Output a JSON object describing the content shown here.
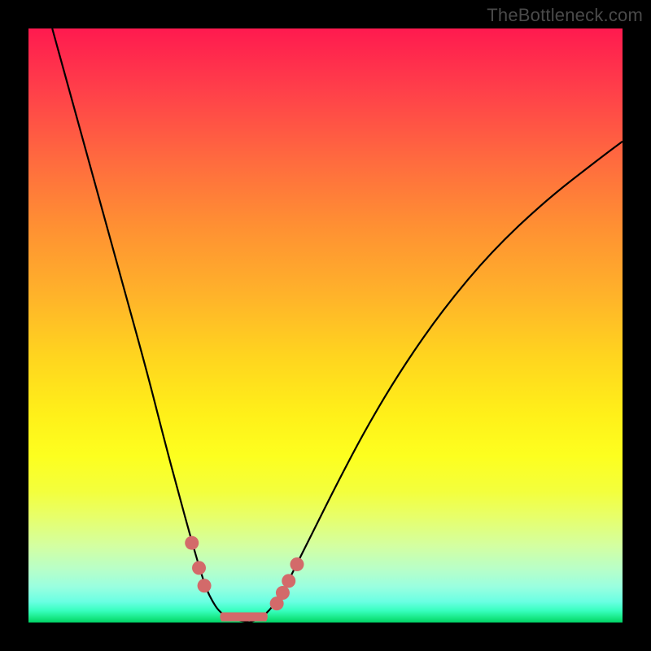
{
  "watermark": "TheBottleneck.com",
  "chart_data": {
    "type": "line",
    "title": "",
    "xlabel": "",
    "ylabel": "",
    "xlim": [
      0,
      1
    ],
    "ylim": [
      0,
      1
    ],
    "series": [
      {
        "name": "left-curve",
        "x": [
          0.04,
          0.08,
          0.12,
          0.16,
          0.2,
          0.228,
          0.252,
          0.274,
          0.29,
          0.3,
          0.31,
          0.32,
          0.333,
          0.352,
          0.372
        ],
        "y": [
          1.0,
          0.855,
          0.71,
          0.565,
          0.42,
          0.31,
          0.22,
          0.14,
          0.085,
          0.055,
          0.035,
          0.02,
          0.01,
          0.004,
          0.0
        ]
      },
      {
        "name": "right-curve",
        "x": [
          0.372,
          0.392,
          0.41,
          0.43,
          0.45,
          0.48,
          0.52,
          0.57,
          0.63,
          0.7,
          0.78,
          0.87,
          0.96,
          1.0
        ],
        "y": [
          0.0,
          0.008,
          0.025,
          0.055,
          0.095,
          0.155,
          0.235,
          0.33,
          0.43,
          0.53,
          0.625,
          0.71,
          0.78,
          0.81
        ]
      }
    ],
    "markers": {
      "name": "dots",
      "color": "#d36a6a",
      "points": [
        {
          "x": 0.275,
          "y": 0.134
        },
        {
          "x": 0.287,
          "y": 0.092
        },
        {
          "x": 0.296,
          "y": 0.062
        },
        {
          "x": 0.325,
          "y": 0.01
        },
        {
          "x": 0.34,
          "y": 0.003
        },
        {
          "x": 0.355,
          "y": 0.0
        },
        {
          "x": 0.37,
          "y": 0.0
        },
        {
          "x": 0.385,
          "y": 0.002
        },
        {
          "x": 0.4,
          "y": 0.01
        },
        {
          "x": 0.418,
          "y": 0.032
        },
        {
          "x": 0.428,
          "y": 0.05
        },
        {
          "x": 0.438,
          "y": 0.07
        },
        {
          "x": 0.452,
          "y": 0.098
        }
      ]
    },
    "colors": {
      "curve": "#000000",
      "marker": "#d36a6a",
      "frame": "#000000"
    }
  }
}
